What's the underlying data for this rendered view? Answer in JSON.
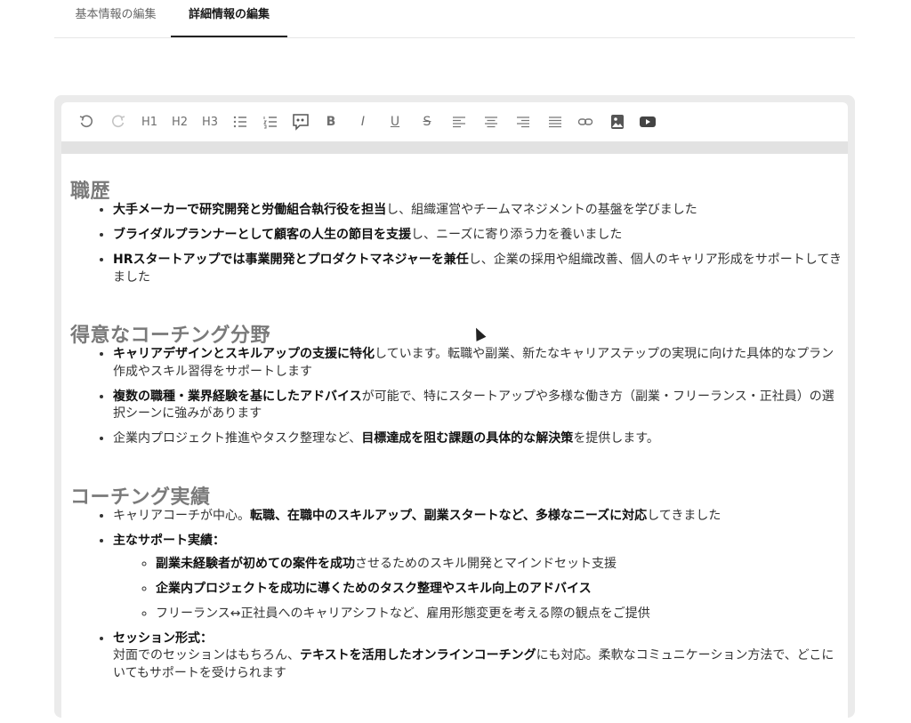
{
  "tabs": [
    {
      "label": "基本情報の編集"
    },
    {
      "label": "詳細情報の編集"
    }
  ],
  "toolbar": {
    "h1": "H1",
    "h2": "H2",
    "h3": "H3",
    "bold": "B",
    "italic": "I",
    "underline": "U",
    "strike": "S"
  },
  "sections": [
    {
      "heading": "職歴",
      "items": [
        {
          "b": "大手メーカーで研究開発と労働組合執行役を担当",
          "t": "し、組織運営やチームマネジメントの基盤を学びました"
        },
        {
          "b": "ブライダルプランナーとして顧客の人生の節目を支援",
          "t": "し、ニーズに寄り添う力を養いました"
        },
        {
          "b": "HRスタートアップでは事業開発とプロダクトマネジャーを兼任",
          "t": "し、企業の採用や組織改善、個人のキャリア形成をサポートしてきました"
        }
      ]
    },
    {
      "heading": "得意なコーチング分野",
      "items": [
        {
          "b": "キャリアデザインとスキルアップの支援に特化",
          "t": "しています。転職や副業、新たなキャリアステップの実現に向けた具体的なプラン作成やスキル習得をサポートします"
        },
        {
          "b": "複数の職種・業界経験を基にしたアドバイス",
          "t": "が可能で、特にスタートアップや多様な働き方（副業・フリーランス・正社員）の選択シーンに強みがあります"
        },
        {
          "pre": "企業内プロジェクト推進やタスク整理など、",
          "b": "目標達成を阻む課題の具体的な解決策",
          "t": "を提供します。"
        }
      ]
    },
    {
      "heading": "コーチング実績",
      "items": [
        {
          "pre": "キャリアコーチが中心。",
          "b": "転職、在職中のスキルアップ、副業スタートなど、多様なニーズに対応",
          "t": "してきました"
        },
        {
          "b": "主なサポート実績：",
          "t": ""
        },
        {
          "b": "セッション形式：",
          "t": ""
        }
      ],
      "sub_items": [
        {
          "b": "副業未経験者が初めての案件を成功",
          "t": "させるためのスキル開発とマインドセット支援"
        },
        {
          "b": "企業内プロジェクトを成功に導くためのタスク整理やスキル向上のアドバイス",
          "t": ""
        },
        {
          "b": "",
          "t": "フリーランス↔正社員へのキャリアシフトなど、雇用形態変更を考える際の観点をご提供"
        }
      ],
      "session": {
        "pre": "対面でのセッションはもちろん、",
        "b": "テキストを活用したオンラインコーチング",
        "t": "にも対応。柔軟なコミュニケーション方法で、どこにいてもサポートを受けられます"
      }
    }
  ]
}
